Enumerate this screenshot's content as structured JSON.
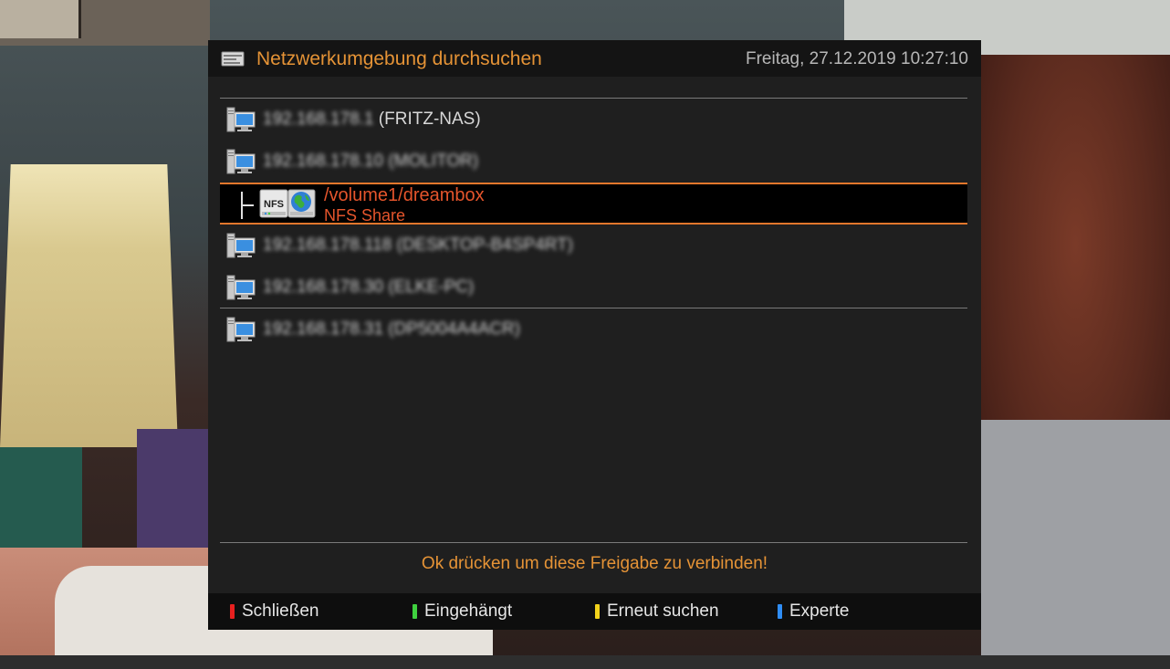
{
  "header": {
    "title": "Netzwerkumgebung durchsuchen",
    "datetime": "Freitag, 27.12.2019   10:27:10",
    "icon": "network-neighborhood-icon"
  },
  "hosts": [
    {
      "label": "192.168.178.1 (FRITZ-NAS)",
      "icon": "computer-icon"
    },
    {
      "label": "192.168.178.10 (MOLITOR)",
      "icon": "computer-icon"
    },
    {
      "label": "192.168.178.118 (DESKTOP-B4SP4RT)",
      "icon": "computer-icon"
    },
    {
      "label": "192.168.178.30 (ELKE-PC)",
      "icon": "computer-icon"
    },
    {
      "label": "192.168.178.31 (DP5004A4ACR)",
      "icon": "computer-icon"
    }
  ],
  "selected_share": {
    "path": "/volume1/dreambox",
    "type": "NFS Share",
    "badge": "NFS",
    "icon": "nfs-share-icon"
  },
  "hint": "Ok drücken um diese Freigabe zu verbinden!",
  "footer": {
    "red": "Schließen",
    "green": "Eingehängt",
    "yellow": "Erneut suchen",
    "blue": "Experte"
  },
  "colors": {
    "accent": "#e59336",
    "selection": "#e5552c",
    "red": "#e8201f",
    "green": "#3fd13f",
    "yellow": "#f2d21b",
    "blue": "#2f8df5"
  }
}
